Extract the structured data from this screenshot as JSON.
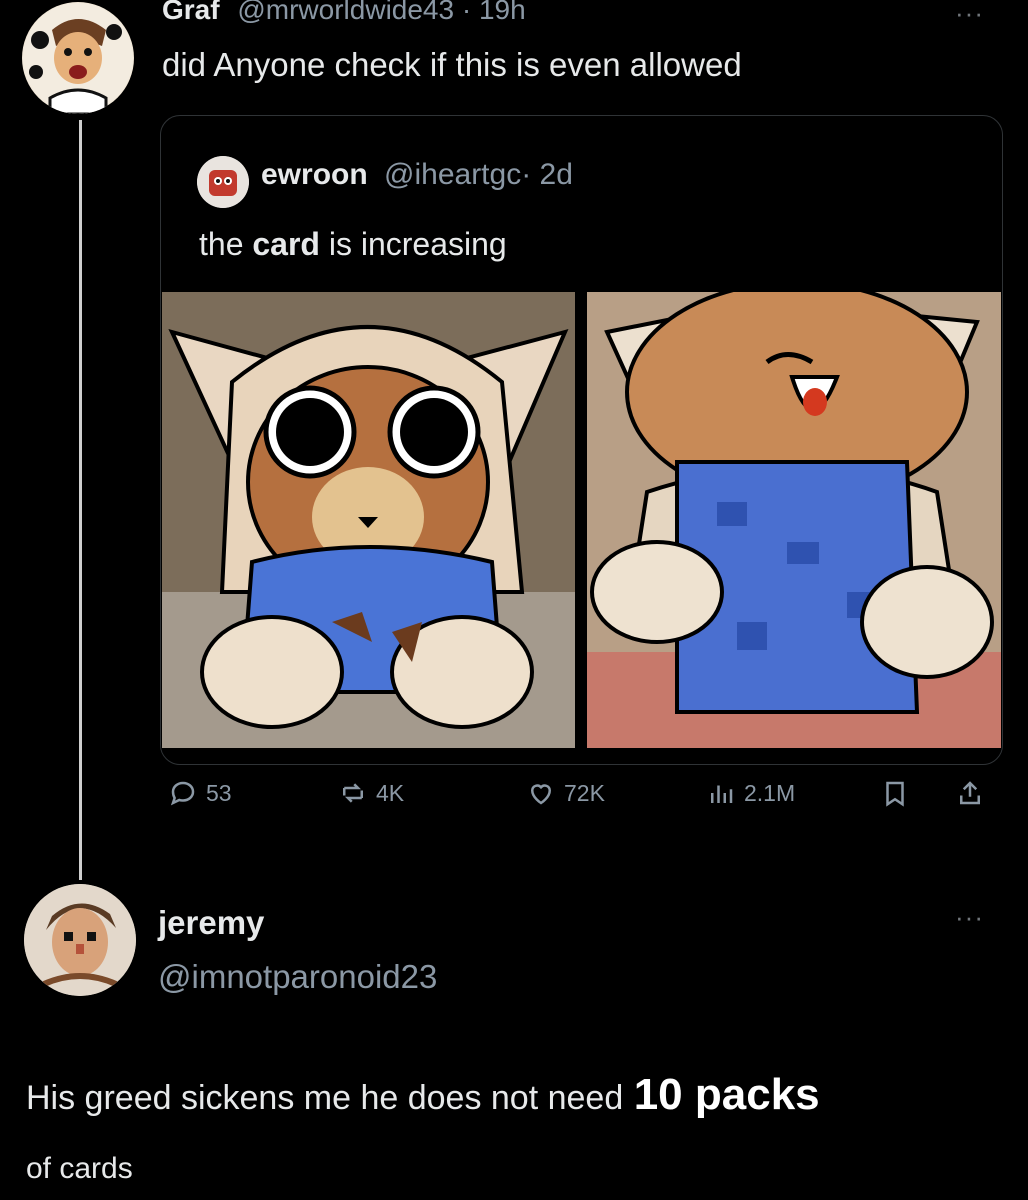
{
  "post": {
    "author_name": "Graf",
    "author_handle": "@mrworldwide43",
    "time": "· 19h",
    "text": "did Anyone check if this is even allowed"
  },
  "quote": {
    "author_name": "ewroon",
    "author_handle": "@iheartgc",
    "time": "· 2d",
    "text_before": "the",
    "text_bold": "card",
    "text_after": "is increasing"
  },
  "actions": {
    "replies": "53",
    "reposts": "4K",
    "likes": "72K",
    "views": "2.1M"
  },
  "reply": {
    "author_name": "jeremy",
    "author_handle": "@imnotparonoid23",
    "text_main": "His greed sickens me he does not need",
    "text_emph": "10 packs",
    "text_tail": "of cards"
  },
  "colors": {
    "background": "#000000",
    "text": "#e7e9ea",
    "muted": "#8b98a5",
    "border": "#2f3336"
  },
  "icons": [
    "more-icon",
    "reply-icon",
    "repost-icon",
    "like-icon",
    "views-icon",
    "bookmark-icon",
    "share-icon"
  ]
}
